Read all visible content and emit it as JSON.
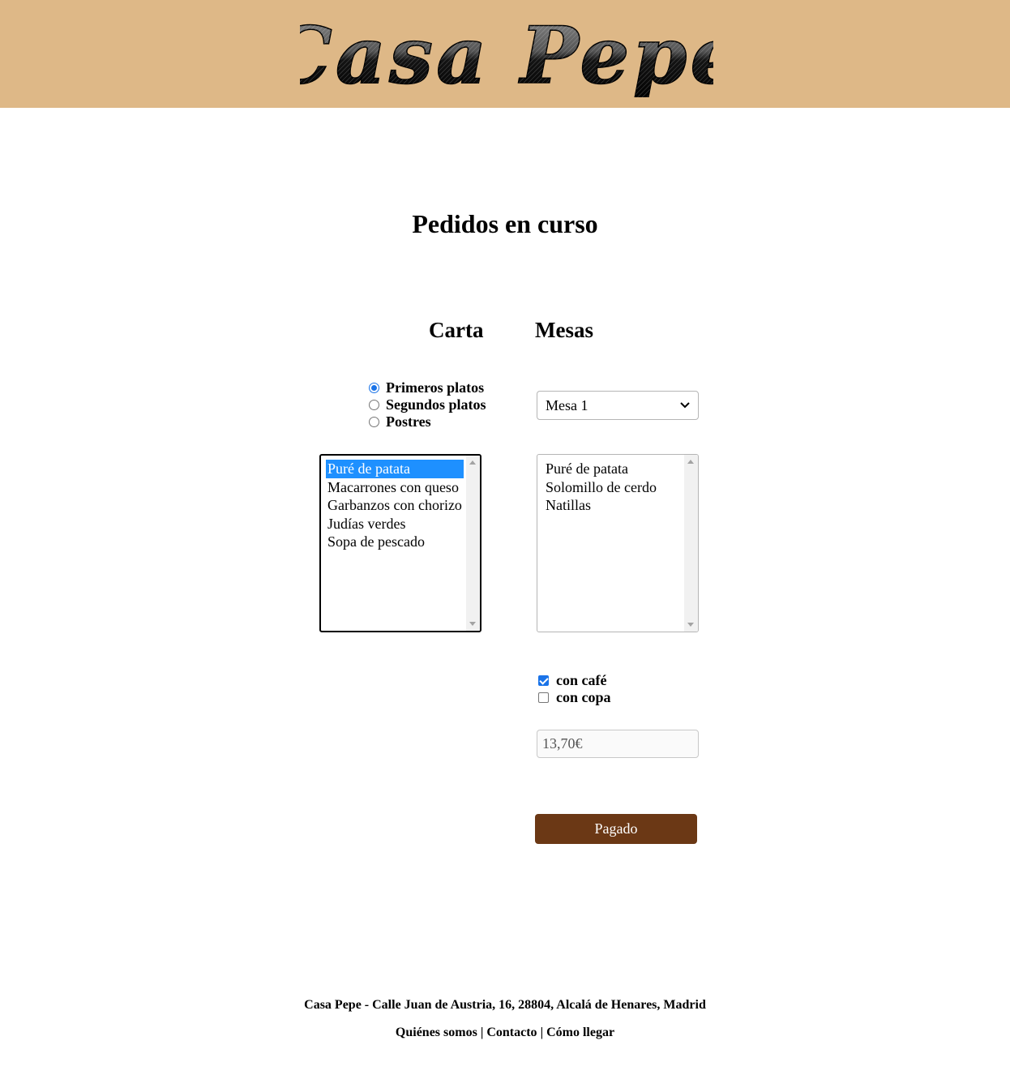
{
  "header": {
    "logo_text": "Casa Pepe",
    "background": "#deb887"
  },
  "main": {
    "title": "Pedidos en curso",
    "carta": {
      "heading": "Carta",
      "categories": [
        {
          "label": "Primeros platos",
          "checked": true
        },
        {
          "label": "Segundos platos",
          "checked": false
        },
        {
          "label": "Postres",
          "checked": false
        }
      ],
      "dishes": [
        "Puré de patata",
        "Macarrones con queso",
        "Garbanzos con chorizo",
        "Judías verdes",
        "Sopa de pescado"
      ],
      "selected_dish": "Puré de patata"
    },
    "mesas": {
      "heading": "Mesas",
      "selected_table": "Mesa 1",
      "order_items": [
        "Puré de patata",
        "Solomillo de cerdo",
        "Natillas"
      ],
      "extras": [
        {
          "label": "con café",
          "checked": true
        },
        {
          "label": "con copa",
          "checked": false
        }
      ],
      "total": "13,70€",
      "pay_label": "Pagado"
    }
  },
  "footer": {
    "address": "Casa Pepe - Calle Juan de Austria, 16, 28804, Alcalá de Henares, Madrid",
    "links": [
      "Quiénes somos",
      "Contacto",
      "Cómo llegar"
    ],
    "separator": "|"
  },
  "colors": {
    "accent": "#1e90ff",
    "button": "#6b3815"
  }
}
